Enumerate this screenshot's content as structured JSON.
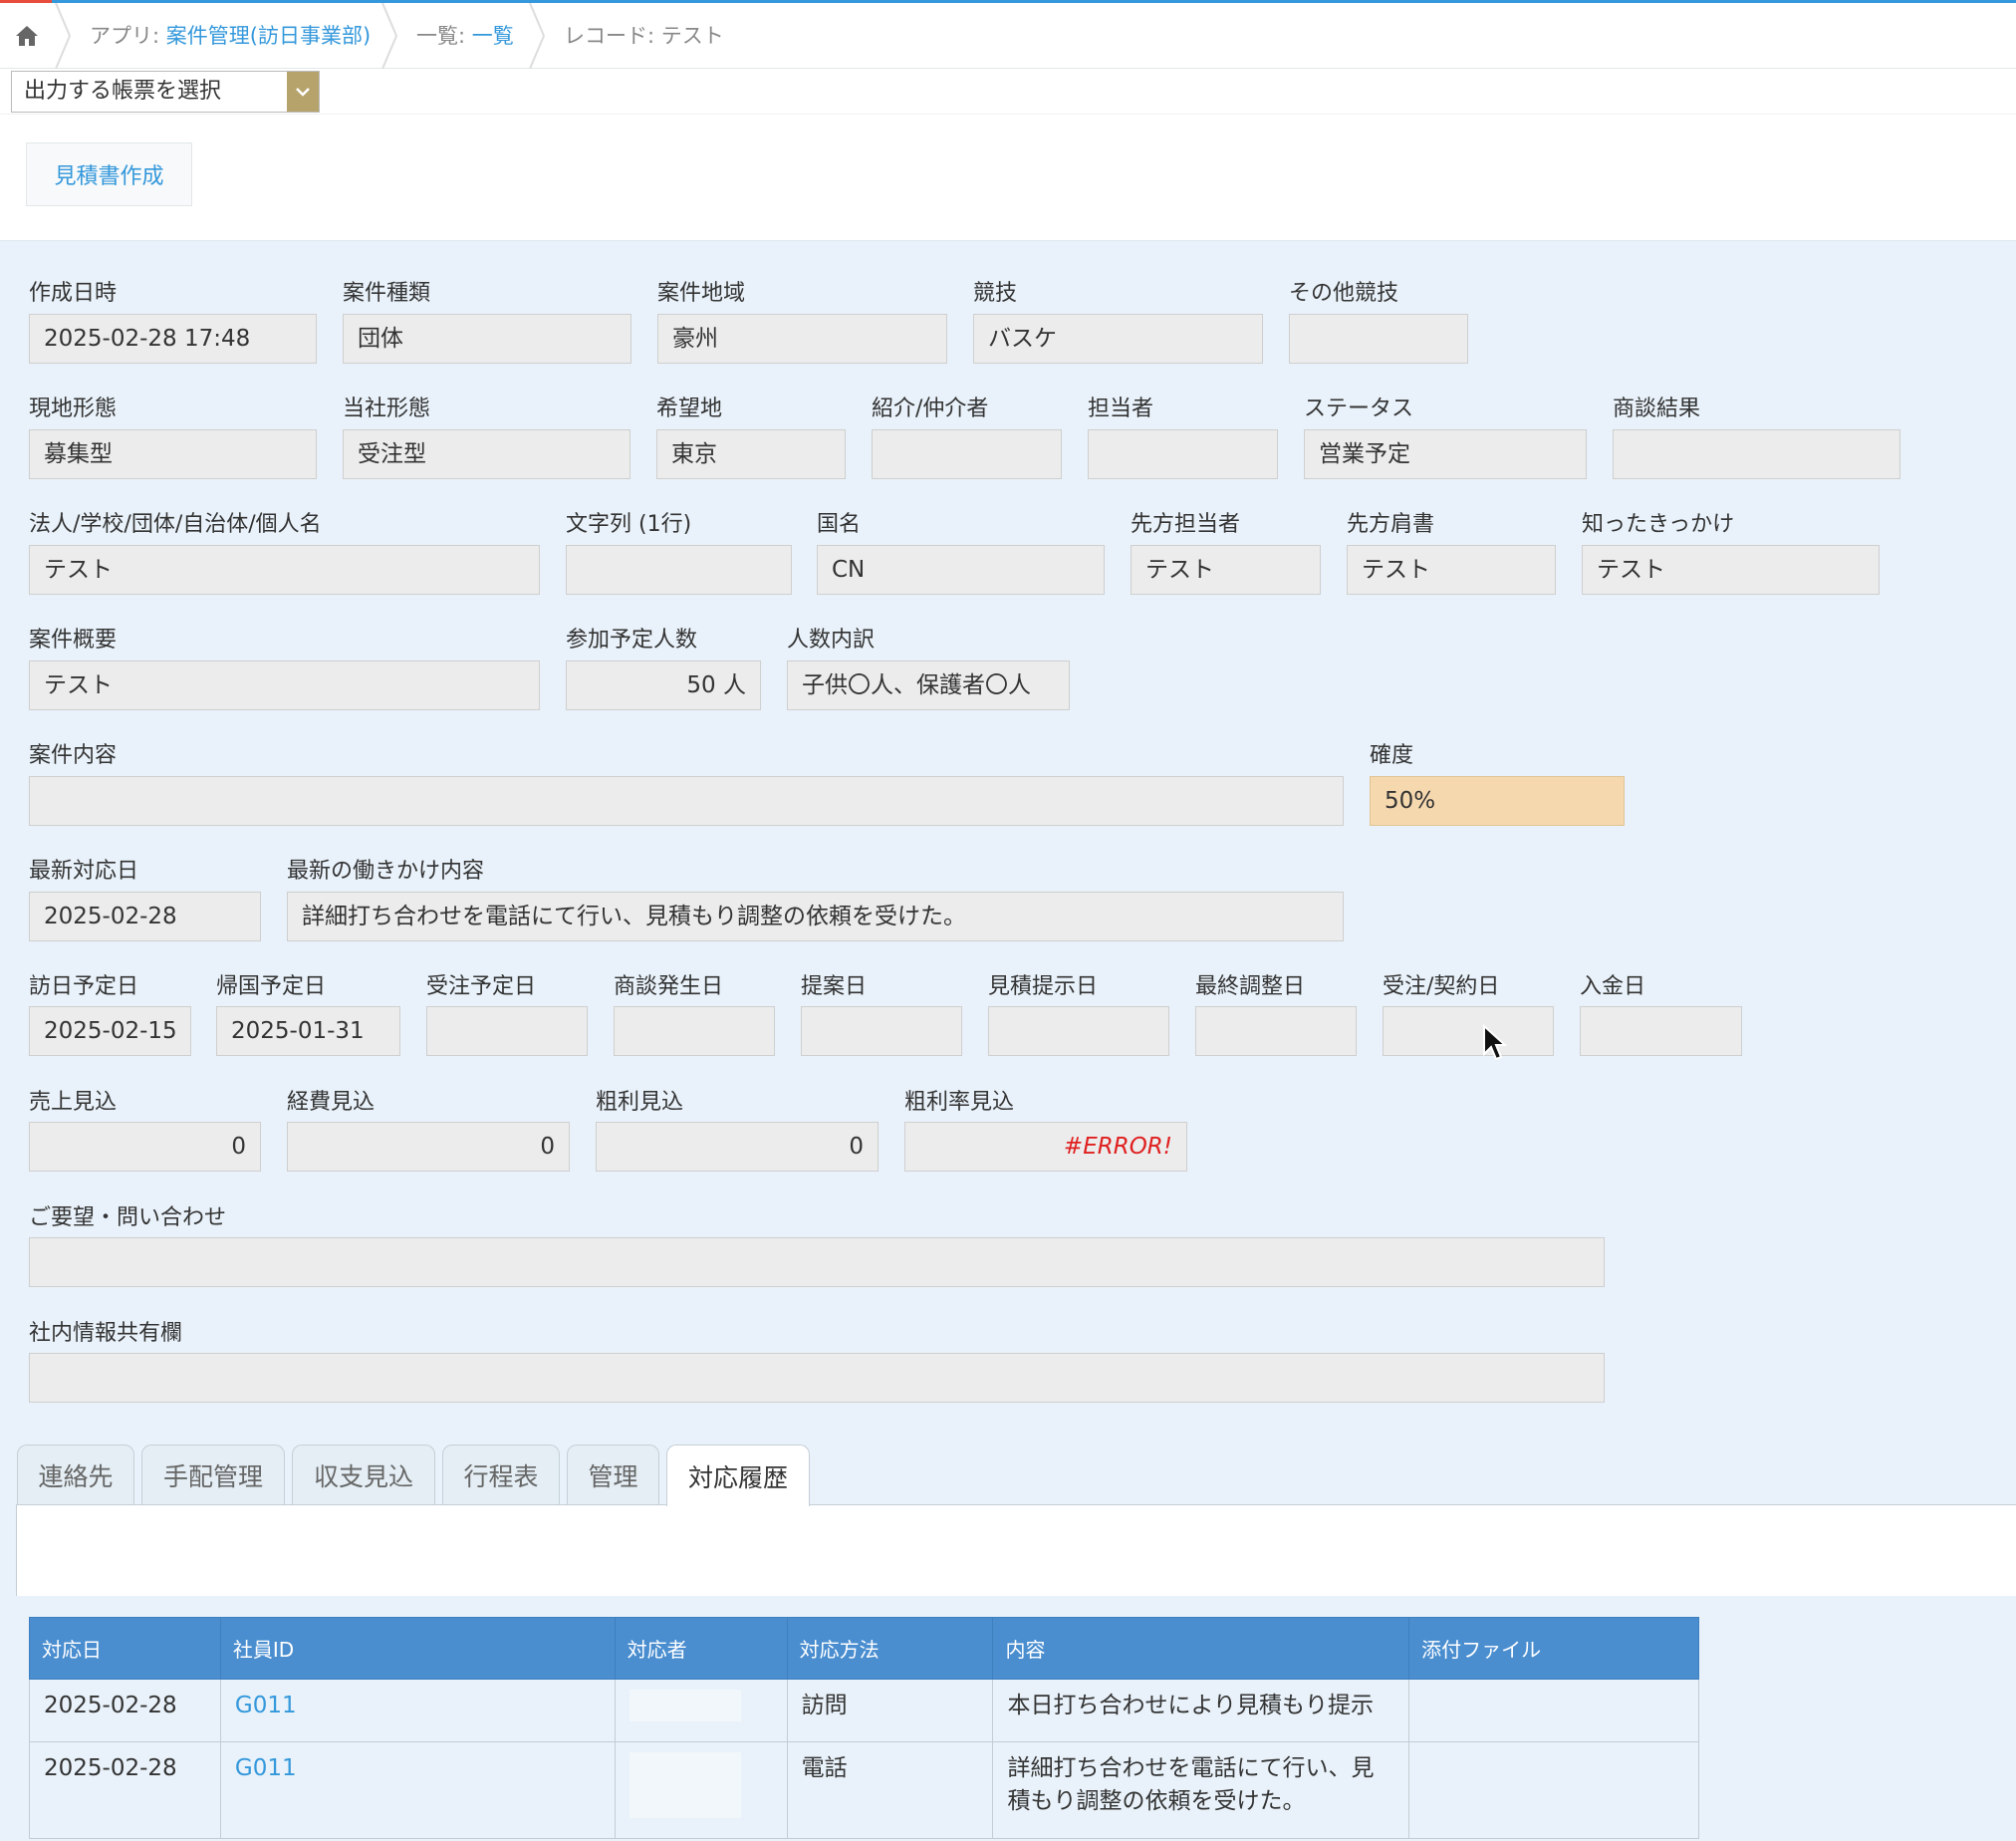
{
  "breadcrumb": {
    "app_prefix": "アプリ: ",
    "app_name": "案件管理(訪日事業部)",
    "list_prefix": "一覧: ",
    "list_name": "一覧",
    "record_prefix": "レコード: ",
    "record_name": "テスト"
  },
  "report_select": {
    "value": "出力する帳票を選択"
  },
  "actions": {
    "estimate_button": "見積書作成"
  },
  "fields": {
    "created_at": {
      "label": "作成日時",
      "value": "2025-02-28 17:48"
    },
    "case_type": {
      "label": "案件種類",
      "value": "団体"
    },
    "case_region": {
      "label": "案件地域",
      "value": "豪州"
    },
    "sport": {
      "label": "競技",
      "value": "バスケ"
    },
    "other_sport": {
      "label": "その他競技",
      "value": ""
    },
    "local_form": {
      "label": "現地形態",
      "value": "募集型"
    },
    "our_form": {
      "label": "当社形態",
      "value": "受注型"
    },
    "desired_place": {
      "label": "希望地",
      "value": "東京"
    },
    "introducer": {
      "label": "紹介/仲介者",
      "value": ""
    },
    "person_in_charge": {
      "label": "担当者",
      "value": ""
    },
    "status": {
      "label": "ステータス",
      "value": "営業予定"
    },
    "negotiation_result": {
      "label": "商談結果",
      "value": ""
    },
    "org_name": {
      "label": "法人/学校/団体/自治体/個人名",
      "value": "テスト"
    },
    "text_line": {
      "label": "文字列 (1行)",
      "value": ""
    },
    "country": {
      "label": "国名",
      "value": "CN"
    },
    "client_contact": {
      "label": "先方担当者",
      "value": "テスト"
    },
    "client_title": {
      "label": "先方肩書",
      "value": "テスト"
    },
    "how_known": {
      "label": "知ったきっかけ",
      "value": "テスト"
    },
    "case_summary": {
      "label": "案件概要",
      "value": "テスト"
    },
    "participants": {
      "label": "参加予定人数",
      "value": "50 人"
    },
    "participants_breakdown": {
      "label": "人数内訳",
      "value": "子供〇人、保護者〇人"
    },
    "case_content": {
      "label": "案件内容",
      "value": ""
    },
    "certainty": {
      "label": "確度",
      "value": "50%"
    },
    "latest_date": {
      "label": "最新対応日",
      "value": "2025-02-28"
    },
    "latest_action": {
      "label": "最新の働きかけ内容",
      "value": "詳細打ち合わせを電話にて行い、見積もり調整の依頼を受けた。"
    },
    "visit_date": {
      "label": "訪日予定日",
      "value": "2025-02-15"
    },
    "return_date": {
      "label": "帰国予定日",
      "value": "2025-01-31"
    },
    "order_planned_date": {
      "label": "受注予定日",
      "value": ""
    },
    "negotiation_date": {
      "label": "商談発生日",
      "value": ""
    },
    "proposal_date": {
      "label": "提案日",
      "value": ""
    },
    "quote_date": {
      "label": "見積提示日",
      "value": ""
    },
    "final_adjust_date": {
      "label": "最終調整日",
      "value": ""
    },
    "contract_date": {
      "label": "受注/契約日",
      "value": ""
    },
    "payment_date": {
      "label": "入金日",
      "value": ""
    },
    "sales_forecast": {
      "label": "売上見込",
      "value": "0"
    },
    "cost_forecast": {
      "label": "経費見込",
      "value": "0"
    },
    "profit_forecast": {
      "label": "粗利見込",
      "value": "0"
    },
    "profit_rate_forecast": {
      "label": "粗利率見込",
      "value": "#ERROR!"
    },
    "requests": {
      "label": "ご要望・問い合わせ",
      "value": ""
    },
    "internal_notes": {
      "label": "社内情報共有欄",
      "value": ""
    }
  },
  "tabs": [
    {
      "label": "連絡先"
    },
    {
      "label": "手配管理"
    },
    {
      "label": "収支見込"
    },
    {
      "label": "行程表"
    },
    {
      "label": "管理"
    },
    {
      "label": "対応履歴"
    }
  ],
  "history_table": {
    "headers": [
      "対応日",
      "社員ID",
      "対応者",
      "対応方法",
      "内容",
      "添付ファイル"
    ],
    "rows": [
      {
        "date": "2025-02-28",
        "employee_id": "G011",
        "method": "訪問",
        "content": "本日打ち合わせにより見積もり提示",
        "attachment": ""
      },
      {
        "date": "2025-02-28",
        "employee_id": "G011",
        "method": "電話",
        "content": "詳細打ち合わせを電話にて行い、見積もり調整の依頼を受けた。",
        "attachment": ""
      }
    ]
  },
  "colors": {
    "accent": "#3498db",
    "form_background": "#e9f2fa",
    "field_background": "#ececec",
    "certainty_highlight": "#f5d8ae",
    "table_header": "#4a8ed0",
    "error_text": "#e02020"
  }
}
